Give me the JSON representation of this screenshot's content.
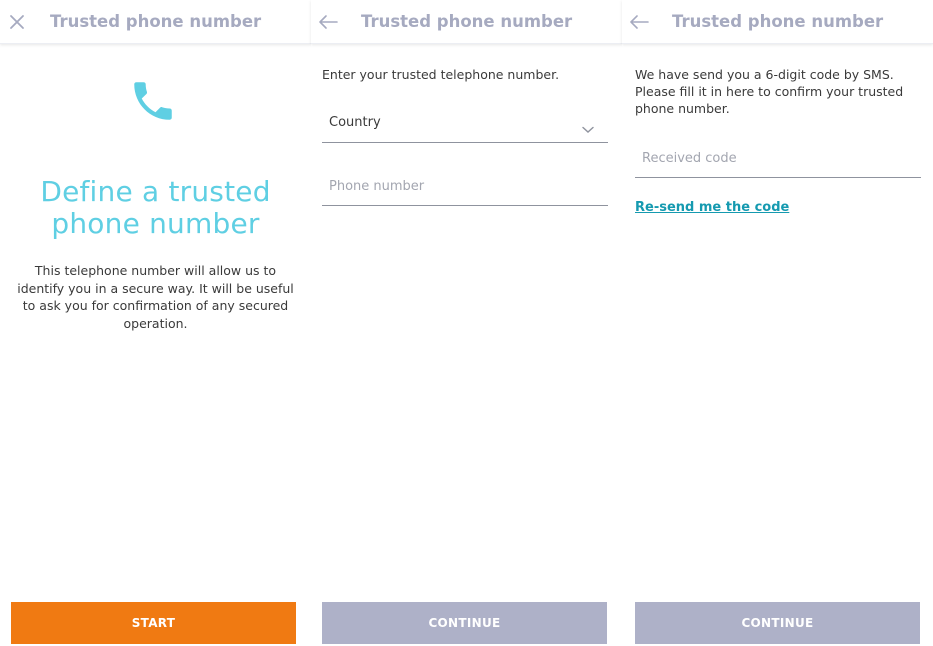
{
  "colors": {
    "accent": "#5fcfe3",
    "primary_button": "#f07a12",
    "disabled_button": "#aeb1c8",
    "header_title": "#a6aac0",
    "link": "#159ab0"
  },
  "screens": [
    {
      "header": {
        "icon": "close-icon",
        "title": "Trusted phone number"
      },
      "illustration_icon": "phone-icon",
      "headline": "Define a trusted phone number",
      "description": "This telephone number will allow us to identify you in a secure way. It will be useful to ask you for confirmation of any secured operation.",
      "button": {
        "label": "START"
      }
    },
    {
      "header": {
        "icon": "back-arrow-icon",
        "title": "Trusted phone number"
      },
      "intro": "Enter your trusted telephone number.",
      "country_select": {
        "placeholder": "Country",
        "icon": "chevron-down-icon"
      },
      "phone_input": {
        "placeholder": "Phone number",
        "value": ""
      },
      "button": {
        "label": "CONTINUE"
      }
    },
    {
      "header": {
        "icon": "back-arrow-icon",
        "title": "Trusted phone number"
      },
      "intro": "We have send you a 6-digit code by SMS. Please fill it in here to confirm your trusted phone number.",
      "code_input": {
        "placeholder": "Received code",
        "value": ""
      },
      "resend_link": "Re-send me the code",
      "button": {
        "label": "CONTINUE"
      }
    }
  ]
}
